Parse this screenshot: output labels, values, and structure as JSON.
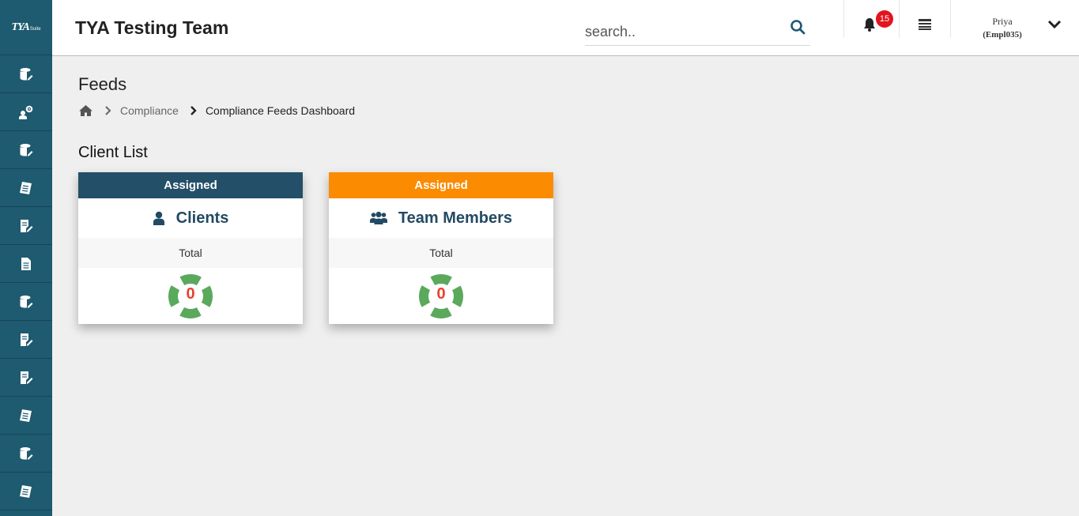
{
  "app": {
    "logo_text": "TYA",
    "logo_sub": "Suite",
    "title": "TYA Testing Team"
  },
  "sidebar": {
    "items": [
      {
        "icon": "database-edit-icon"
      },
      {
        "icon": "user-gear-icon"
      },
      {
        "icon": "database-edit-icon"
      },
      {
        "icon": "checklist-icon"
      },
      {
        "icon": "document-edit-icon"
      },
      {
        "icon": "document-icon"
      },
      {
        "icon": "database-edit-icon"
      },
      {
        "icon": "document-edit-icon"
      },
      {
        "icon": "document-edit-icon"
      },
      {
        "icon": "checklist-icon"
      },
      {
        "icon": "database-edit-icon"
      },
      {
        "icon": "checklist-icon"
      }
    ]
  },
  "header": {
    "search_placeholder": "search..",
    "notification_count": "15",
    "user_name": "Priya",
    "user_id": "(Empl035)"
  },
  "page": {
    "title": "Feeds",
    "breadcrumb": [
      "Compliance",
      "Compliance Feeds Dashboard"
    ],
    "section_title": "Client List"
  },
  "cards": [
    {
      "header": "Assigned",
      "header_color": "#234f68",
      "title": "Clients",
      "icon": "user-icon",
      "subtitle": "Total",
      "value": "0"
    },
    {
      "header": "Assigned",
      "header_color": "#fb8b00",
      "title": "Team Members",
      "icon": "users-icon",
      "subtitle": "Total",
      "value": "0"
    }
  ],
  "colors": {
    "sidebar": "#1e5a70",
    "donut": "#5aa95c",
    "donut_value": "#e8412c",
    "badge": "#e2141f"
  }
}
